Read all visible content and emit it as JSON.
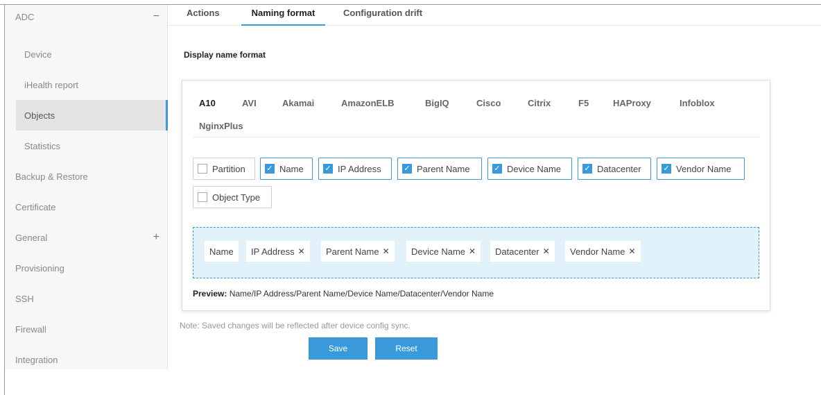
{
  "sidebar": {
    "adc": {
      "label": "ADC",
      "toggle": "−"
    },
    "sub_items": [
      "Device",
      "iHealth report",
      "Objects",
      "Statistics"
    ],
    "items": [
      "Backup & Restore",
      "Certificate",
      "General",
      "Provisioning",
      "SSH",
      "Firewall",
      "Integration"
    ],
    "general_toggle": "+"
  },
  "tabs": {
    "actions": "Actions",
    "naming_format": "Naming format",
    "configuration_drift": "Configuration drift"
  },
  "section_title": "Display name format",
  "vendors": [
    "A10",
    "AVI",
    "Akamai",
    "AmazonELB",
    "BigIQ",
    "Cisco",
    "Citrix",
    "F5",
    "HAProxy",
    "Infoblox",
    "NginxPlus"
  ],
  "fields": [
    {
      "label": "Partition",
      "checked": false
    },
    {
      "label": "Name",
      "checked": true
    },
    {
      "label": "IP Address",
      "checked": true
    },
    {
      "label": "Parent Name",
      "checked": true
    },
    {
      "label": "Device Name",
      "checked": true
    },
    {
      "label": "Datacenter",
      "checked": true
    },
    {
      "label": "Vendor Name",
      "checked": true
    },
    {
      "label": "Object Type",
      "checked": false
    }
  ],
  "selected_chips": [
    {
      "label": "Name",
      "removable": false
    },
    {
      "label": "IP Address",
      "removable": true
    },
    {
      "label": "Parent Name",
      "removable": true
    },
    {
      "label": "Device Name",
      "removable": true
    },
    {
      "label": "Datacenter",
      "removable": true
    },
    {
      "label": "Vendor Name",
      "removable": true
    }
  ],
  "preview": {
    "label": "Preview:",
    "value": "Name/IP Address/Parent Name/Device Name/Datacenter/Vendor Name"
  },
  "note": "Note: Saved changes will be reflected after device config sync.",
  "buttons": {
    "save": "Save",
    "reset": "Reset"
  },
  "colors": {
    "accent": "#3a9ad9",
    "dropzone_bg": "#e2f2fb"
  }
}
